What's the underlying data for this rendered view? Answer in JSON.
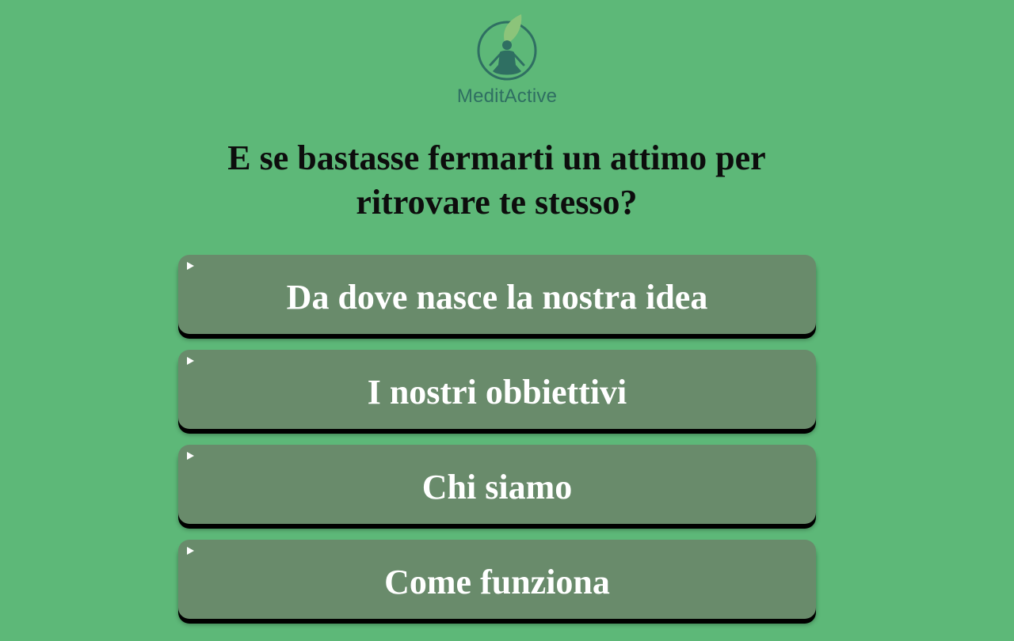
{
  "brand": {
    "name": "MeditActive",
    "icon": "meditation-leaf-icon",
    "colors": {
      "background": "#5db878",
      "brand_text": "#2f6f62",
      "card": "#698b6b",
      "leaf": "#8cc47a"
    }
  },
  "headline": "E se bastasse fermarti un attimo per ritrovare te stesso?",
  "faq": {
    "marker_icon": "disclosure-triangle-icon",
    "items": [
      {
        "label": "Da dove nasce la nostra idea"
      },
      {
        "label": "I nostri obbiettivi"
      },
      {
        "label": "Chi siamo"
      },
      {
        "label": "Come funziona"
      }
    ]
  }
}
